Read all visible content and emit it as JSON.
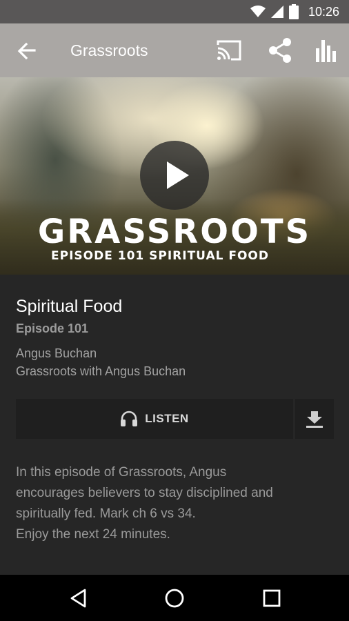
{
  "status_bar": {
    "time": "10:26",
    "icons": [
      "wifi-icon",
      "cell-signal-icon",
      "battery-icon"
    ]
  },
  "toolbar": {
    "title": "Grassroots",
    "icons": [
      "back-arrow-icon",
      "cast-icon",
      "share-icon",
      "bar-chart-icon"
    ],
    "background": "#aaa7a4"
  },
  "hero": {
    "title": "GRASSROOTS",
    "subtitle": "EPISODE 101 SPIRITUAL FOOD",
    "play_icon": "play-icon"
  },
  "episode": {
    "title": "Spiritual Food",
    "number": "Episode 101",
    "author": "Angus Buchan",
    "show": "Grassroots with Angus Buchan"
  },
  "actions": {
    "listen_label": "LISTEN",
    "listen_icon": "headphones-icon",
    "download_icon": "download-icon"
  },
  "description": {
    "lines": [
      "In this episode of Grassroots, Angus",
      "encourages believers to stay disciplined and",
      "spiritually fed. Mark ch 6 vs 34.",
      "Enjoy the next 24 minutes."
    ]
  },
  "nav_bar": {
    "icons": [
      "back-triangle-icon",
      "home-circle-icon",
      "recents-square-icon"
    ]
  },
  "colors": {
    "background": "#262626",
    "button": "#1f1f1f",
    "text_muted": "#9a9a9a"
  }
}
